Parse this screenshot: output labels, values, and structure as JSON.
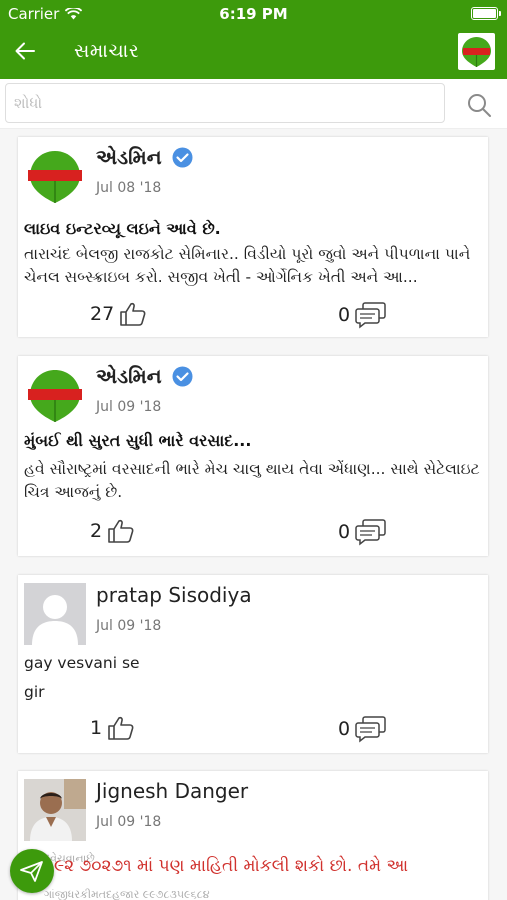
{
  "status_bar": {
    "carrier": "Carrier",
    "time": "6:19 PM"
  },
  "header": {
    "title": "સમાચાર",
    "back_icon": "back-arrow-icon",
    "logo": "pipla-na-pane-logo"
  },
  "search": {
    "placeholder": "શોધો",
    "value": ""
  },
  "posts": [
    {
      "author": "એડમિન",
      "verified": true,
      "date": "Jul 08 '18",
      "title": "લાઇવ ઇન્ટરવ્યૂ લઇને આવે છે.",
      "body": "તારાચંદ બેલજી રાજકોટ સેમિનાર.. વિડીયો પૂરો જુવો અને પીપળાના પાને ચેનલ સબ્સ્ક્રાઇબ કરો. સજીવ ખેતી - ઓર્ગેનિક ખેતી અને આ...",
      "likes": "27",
      "comments": "0"
    },
    {
      "author": "એડમિન",
      "verified": true,
      "date": "Jul 09 '18",
      "title": "મુંબઈ થી સુરત સુધી ભારે વરસાદ...",
      "body": "હવે સૌરાષ્ટ્રમાં વરસાદની ભારે મેચ ચાલુ થાય તેવા એંધાણ... સાથે સેટેલાઇટ ચિત્ર આજનું છે.",
      "likes": "2",
      "comments": "0"
    },
    {
      "author": "pratap Sisodiya",
      "verified": false,
      "date": "Jul 09 '18",
      "title": "gay vesvani se",
      "body": "gir",
      "likes": "1",
      "comments": "0"
    },
    {
      "author": "Jignesh Danger",
      "verified": false,
      "date": "Jul 09 '18"
    }
  ],
  "ticker": {
    "text": "૯૨ ૭૦૨૭૧ માં પણ માહિતી મોકલી શકો છો.     તમે આ",
    "background_line1": "દવેચવાનાછે",
    "background_line2": "ગાંજીધરકીમતદહજાર ૯૯૭૮૩૫૯૬૮૪"
  },
  "colors": {
    "brand_green": "#3d9a0c",
    "ticker_red": "#d0312d",
    "verified_blue": "#4a90e2"
  }
}
